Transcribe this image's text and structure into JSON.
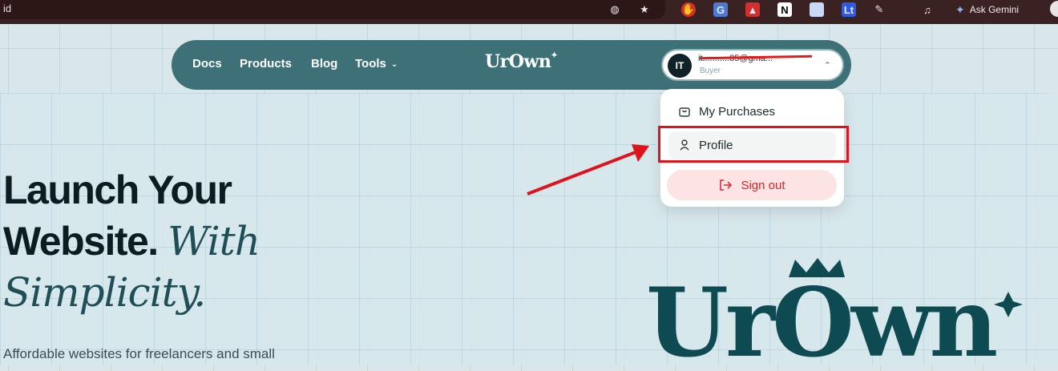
{
  "browser": {
    "url_fragment": "id",
    "gemini_label": "Ask Gemini"
  },
  "nav": {
    "links": [
      "Docs",
      "Products",
      "Blog",
      "Tools"
    ],
    "brand": "UrOwn",
    "user": {
      "initials": "IT",
      "email": "it...........85@gma...",
      "role": "Buyer"
    }
  },
  "dropdown": {
    "items": [
      "My Purchases",
      "Profile"
    ],
    "signout": "Sign out"
  },
  "hero": {
    "title_line1": "Launch Your",
    "title_line2_bold": "Website.",
    "title_line2_italic": "With",
    "title_line3_italic": "Simplicity.",
    "subtitle": "Affordable websites for freelancers and small"
  },
  "logo": {
    "text": "UrOwn"
  },
  "colors": {
    "nav_bg": "#3e7077",
    "brand_dark": "#0e4a52",
    "signout_red": "#d8252b",
    "annotation_red": "#e0131d"
  }
}
